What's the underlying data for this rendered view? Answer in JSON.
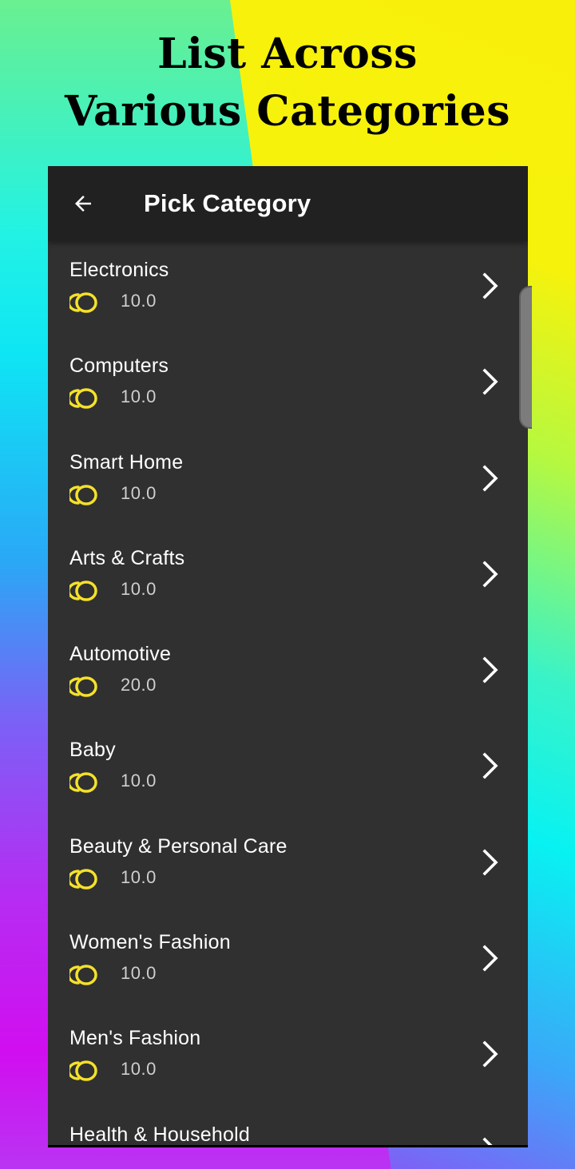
{
  "headline": {
    "line1": "List Across",
    "line2": "Various Categories"
  },
  "appbar": {
    "title": "Pick Category",
    "back_icon": "arrow-back-icon"
  },
  "colors": {
    "appbar_bg": "#212121",
    "list_bg": "#303030",
    "coin": "#f5e12a",
    "text": "#ffffff",
    "value_text": "#cfcfcf"
  },
  "categories": [
    {
      "name": "Electronics",
      "value": "10.0"
    },
    {
      "name": "Computers",
      "value": "10.0"
    },
    {
      "name": "Smart Home",
      "value": "10.0"
    },
    {
      "name": "Arts & Crafts",
      "value": "10.0"
    },
    {
      "name": "Automotive",
      "value": "20.0"
    },
    {
      "name": "Baby",
      "value": "10.0"
    },
    {
      "name": "Beauty & Personal Care",
      "value": "10.0"
    },
    {
      "name": "Women's Fashion",
      "value": "10.0"
    },
    {
      "name": "Men's Fashion",
      "value": "10.0"
    },
    {
      "name": "Health & Household",
      "value": ""
    }
  ]
}
